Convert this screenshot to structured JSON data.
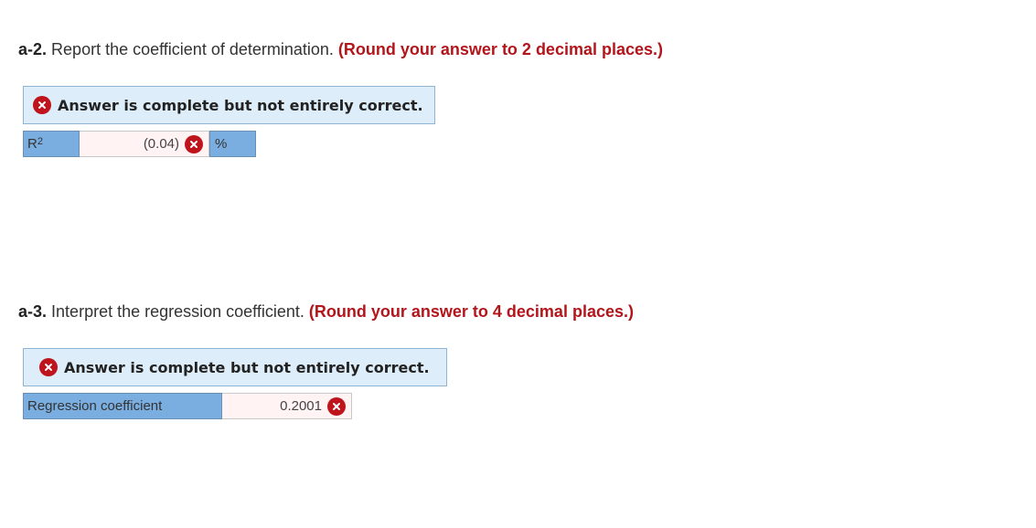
{
  "q_a2": {
    "number": "a-2.",
    "text": "Report the coefficient of determination.",
    "note": "(Round your answer to 2 decimal places.)",
    "banner": "Answer is complete but not entirely correct.",
    "row": {
      "label_base": "R",
      "label_sup": "2",
      "value": "(0.04)",
      "unit": "%"
    }
  },
  "q_a3": {
    "number": "a-3.",
    "text": "Interpret the regression coefficient.",
    "note": "(Round your answer to 4 decimal places.)",
    "banner": "Answer is complete but not entirely correct.",
    "row": {
      "label": "Regression coefficient",
      "value": "0.2001"
    }
  },
  "icons": {
    "incorrect": "x-circle-icon"
  },
  "colors": {
    "incorrect_red": "#c0141c",
    "note_red": "#b3151b",
    "banner_bg": "#ddeefa",
    "label_blue": "#7aaee0",
    "input_bg": "#fff3f3"
  }
}
